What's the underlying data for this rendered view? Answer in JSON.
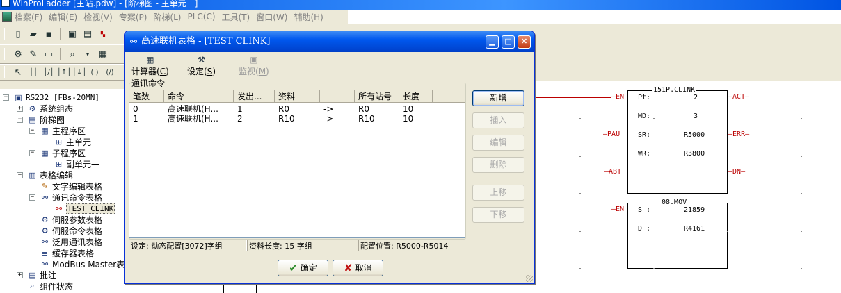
{
  "main_window": {
    "title": "WinProLadder [主站.pdw] - [阶梯图 - 主单元一]"
  },
  "menubar": {
    "items": [
      "档案(F)",
      "编辑(E)",
      "检视(V)",
      "专案(P)",
      "阶梯(L)",
      "PLC(C)",
      "工具(T)",
      "窗口(W)",
      "辅助(H)"
    ]
  },
  "toolbar": {
    "icons": [
      "new-file-icon",
      "open-folder-icon",
      "save-icon",
      "project-icon",
      "monitor-icon",
      "or-and-icon"
    ]
  },
  "project_tree": {
    "nodes": [
      {
        "label": "RS232 [FBs-20MN]",
        "expander": "−",
        "icon": "plc-icon"
      },
      {
        "label": "系统组态",
        "expander": "+",
        "icon": "config-icon"
      },
      {
        "label": "阶梯图",
        "expander": "−",
        "icon": "ladder-icon"
      },
      {
        "label": "主程序区",
        "expander": "−",
        "icon": "program-icon"
      },
      {
        "label": "主单元一",
        "expander": "",
        "icon": "unit-icon"
      },
      {
        "label": "子程序区",
        "expander": "−",
        "icon": "program-icon"
      },
      {
        "label": "副单元一",
        "expander": "",
        "icon": "unit-icon"
      },
      {
        "label": "表格编辑",
        "expander": "−",
        "icon": "table-icon"
      },
      {
        "label": "文字编辑表格",
        "expander": "",
        "icon": "text-table-icon"
      },
      {
        "label": "通讯命令表格",
        "expander": "−",
        "icon": "comm-table-icon"
      },
      {
        "label": "TEST CLINK",
        "expander": "",
        "icon": "clink-icon"
      },
      {
        "label": "伺服参数表格",
        "expander": "",
        "icon": "servo-icon"
      },
      {
        "label": "伺服命令表格",
        "expander": "",
        "icon": "servo-icon"
      },
      {
        "label": "泛用通讯表格",
        "expander": "",
        "icon": "comm-table-icon"
      },
      {
        "label": "缓存器表格",
        "expander": "",
        "icon": "register-icon"
      },
      {
        "label": "ModBus Master表",
        "expander": "",
        "icon": "modbus-icon"
      },
      {
        "label": "批注",
        "expander": "+",
        "icon": "comment-icon"
      },
      {
        "label": "组件状态",
        "expander": "",
        "icon": "status-icon"
      }
    ]
  },
  "ladder": {
    "block1": {
      "title": "151P.CLINK",
      "rows": [
        {
          "label": "Pt:",
          "value": "2"
        },
        {
          "label": "MD:",
          "value": "3"
        },
        {
          "label": "SR:",
          "value": "R5000"
        },
        {
          "label": "WR:",
          "value": "R3800"
        }
      ],
      "inputs": [
        "EN",
        "PAU",
        "ABT"
      ],
      "outputs": [
        "ACT",
        "ERR",
        "DN"
      ]
    },
    "block2": {
      "title": "08.MOV",
      "rows": [
        {
          "label": "S :",
          "value": "21859"
        },
        {
          "label": "D :",
          "value": "R4161"
        }
      ],
      "inputs": [
        "EN"
      ]
    }
  },
  "dialog": {
    "title": "高速联机表格 - [TEST CLINK]",
    "tools": [
      {
        "label": "计算器(",
        "hotkey": "C",
        "suffix": ")",
        "enabled": true
      },
      {
        "label": "设定(",
        "hotkey": "S",
        "suffix": ")",
        "enabled": true
      },
      {
        "label": "监视(",
        "hotkey": "M",
        "suffix": ")",
        "enabled": false
      }
    ],
    "group_label": "通讯命令",
    "columns": [
      "笔数",
      "命令",
      "发出...",
      "资料",
      "",
      "所有站号",
      "长度"
    ],
    "rows": [
      [
        "0",
        "高速联机(H...",
        "1",
        "R0",
        "->",
        "R0",
        "10"
      ],
      [
        "1",
        "高速联机(H...",
        "2",
        "R10",
        "->",
        "R10",
        "10"
      ]
    ],
    "status": [
      "设定: 动态配置[3072]字组",
      "资料长度: 15 字组",
      "配置位置: R5000-R5014"
    ],
    "side_buttons": [
      {
        "label": "新增",
        "enabled": true
      },
      {
        "label": "插入",
        "enabled": false
      },
      {
        "label": "编辑",
        "enabled": false
      },
      {
        "label": "删除",
        "enabled": false
      },
      {
        "label": "上移",
        "enabled": false
      },
      {
        "label": "下移",
        "enabled": false
      }
    ],
    "ok_label": "确定",
    "cancel_label": "取消"
  }
}
